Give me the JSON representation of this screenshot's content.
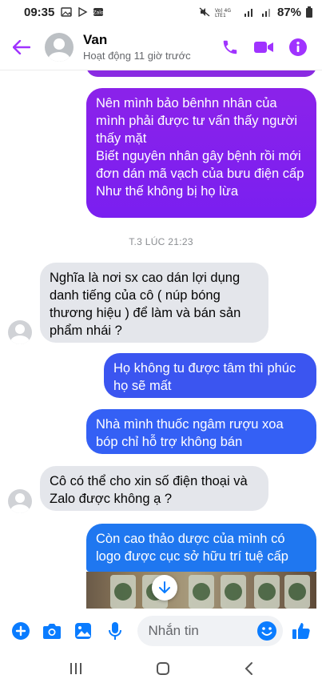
{
  "status_bar": {
    "time": "09:35",
    "battery": "87%",
    "network": "VoLTE1 4G LTE1"
  },
  "header": {
    "contact_name": "Van",
    "contact_status": "Hoạt động 11 giờ trước",
    "accent_color": "#a033ff"
  },
  "messages": [
    {
      "from": "me",
      "text": "Nên mình bảo bênhn nhân của mình phải được tư vấn thấy người thấy mặt\nBiết nguyên nhân gây bệnh rồi mới đơn dán mã vạch của bưu điện cấp\nNhư thế không bị họ lừa",
      "color": "#8b22ea"
    },
    {
      "from": "timestamp",
      "text": "T.3 LÚC 21:23"
    },
    {
      "from": "them",
      "text": "Nghĩa là nơi sx cao dán lợi dụng danh tiếng của cô ( núp bóng thương hiệu ) để làm và bán sản phẩm nhái ?"
    },
    {
      "from": "me",
      "text": "Họ không tu được tâm thì phúc họ sẽ mất",
      "color": "#3b55f0"
    },
    {
      "from": "me",
      "text": "Nhà mình thuốc ngâm rượu xoa bóp chỉ hỗ trợ không  bán",
      "color": "#3460f5"
    },
    {
      "from": "them",
      "text": "Cô có thể cho xin số điện thoại và Zalo được không ạ ?"
    },
    {
      "from": "me",
      "text": "Còn cao thảo dược của mình có logo được cục sở hữu trí tuệ cấp",
      "color": "#1f77f0"
    }
  ],
  "composer": {
    "placeholder": "Nhắn tin"
  },
  "colors": {
    "icon_blue": "#0a7cff",
    "header_purple": "#a033ff"
  }
}
